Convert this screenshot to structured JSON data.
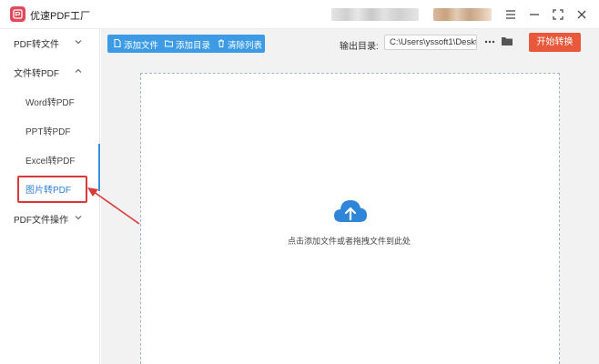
{
  "window": {
    "title": "优速PDF工厂",
    "logo_icon": "pdf-app-logo",
    "controls": [
      "menu-icon",
      "minimize-icon",
      "maximize-icon",
      "close-icon"
    ]
  },
  "sidebar": {
    "groups": [
      {
        "label": "PDF转文件",
        "icon": "chevron-down-icon"
      },
      {
        "label": "文件转PDF",
        "icon": "chevron-up-icon",
        "items": [
          "Word转PDF",
          "PPT转PDF",
          "Excel转PDF",
          "图片转PDF"
        ]
      },
      {
        "label": "PDF文件操作",
        "icon": "chevron-down-icon"
      }
    ],
    "active_item": "图片转PDF"
  },
  "toolbar": {
    "add_file": "添加文件",
    "add_folder": "添加目录",
    "clear_list": "清除列表",
    "output_label": "输出目录:",
    "output_path": "C:\\Users\\yssoft1\\Deskt",
    "start_button": "开始转换"
  },
  "drop_zone": {
    "hint": "点击添加文件或者拖拽文件到此处",
    "icon": "cloud-upload-icon"
  },
  "colors": {
    "accent_blue": "#3d9be6",
    "start_orange": "#e9583a",
    "highlight_red": "#d83a3a",
    "logo_red": "#e24a5c"
  }
}
